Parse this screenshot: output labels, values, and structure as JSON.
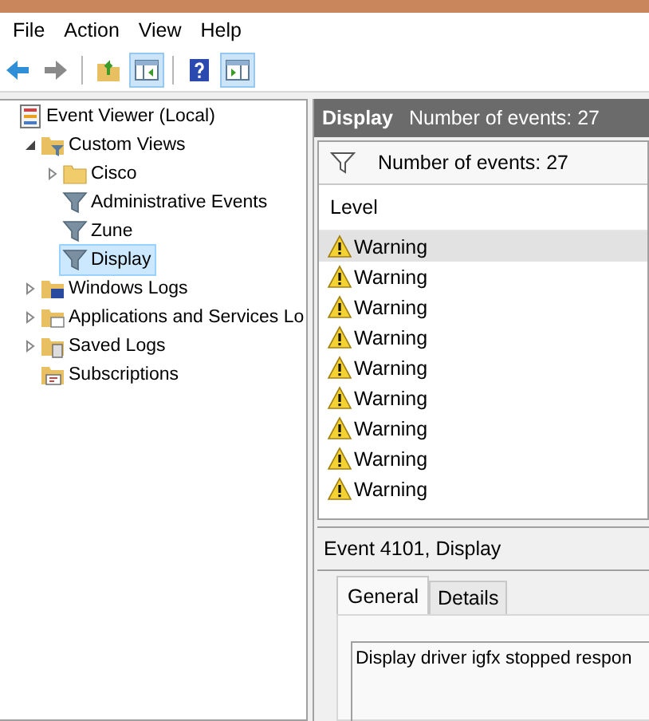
{
  "menu": [
    "File",
    "Action",
    "View",
    "Help"
  ],
  "toolbar": [
    {
      "kind": "back",
      "pressed": false
    },
    {
      "kind": "forward",
      "pressed": false
    },
    {
      "kind": "separator"
    },
    {
      "kind": "up-folder",
      "pressed": false
    },
    {
      "kind": "console-tree",
      "pressed": true
    },
    {
      "kind": "separator"
    },
    {
      "kind": "help",
      "pressed": false
    },
    {
      "kind": "action-pane",
      "pressed": true
    }
  ],
  "tree": [
    {
      "label": "Event Viewer (Local)",
      "kind": "viewer",
      "selected": false,
      "children": [
        {
          "label": "Custom Views",
          "kind": "filter-folder",
          "expanded": true,
          "selected": false,
          "children": [
            {
              "label": "Cisco",
              "kind": "folder",
              "expanded": false,
              "selected": false
            },
            {
              "label": "Administrative Events",
              "kind": "filter",
              "selected": false
            },
            {
              "label": "Zune",
              "kind": "filter",
              "selected": false
            },
            {
              "label": "Display",
              "kind": "filter",
              "selected": true
            }
          ]
        },
        {
          "label": "Windows Logs",
          "kind": "logs-folder",
          "expanded": false,
          "selected": false
        },
        {
          "label": "Applications and Services Lo",
          "kind": "app-folder",
          "expanded": false,
          "selected": false
        },
        {
          "label": "Saved Logs",
          "kind": "saved-folder",
          "expanded": false,
          "selected": false
        },
        {
          "label": "Subscriptions",
          "kind": "subscriptions",
          "selected": false
        }
      ]
    }
  ],
  "header": {
    "title": "Display",
    "subtitle": "Number of events: 27"
  },
  "filter_bar": {
    "text": "Number of events: 27"
  },
  "table": {
    "columns": [
      "Level"
    ],
    "rows": [
      {
        "level": "Warning",
        "selected": true
      },
      {
        "level": "Warning",
        "selected": false
      },
      {
        "level": "Warning",
        "selected": false
      },
      {
        "level": "Warning",
        "selected": false
      },
      {
        "level": "Warning",
        "selected": false
      },
      {
        "level": "Warning",
        "selected": false
      },
      {
        "level": "Warning",
        "selected": false
      },
      {
        "level": "Warning",
        "selected": false
      },
      {
        "level": "Warning",
        "selected": false
      }
    ]
  },
  "details": {
    "title": "Event 4101, Display",
    "tabs": [
      {
        "label": "General",
        "selected": true
      },
      {
        "label": "Details",
        "selected": false
      }
    ],
    "message": "Display driver igfx stopped respon"
  }
}
